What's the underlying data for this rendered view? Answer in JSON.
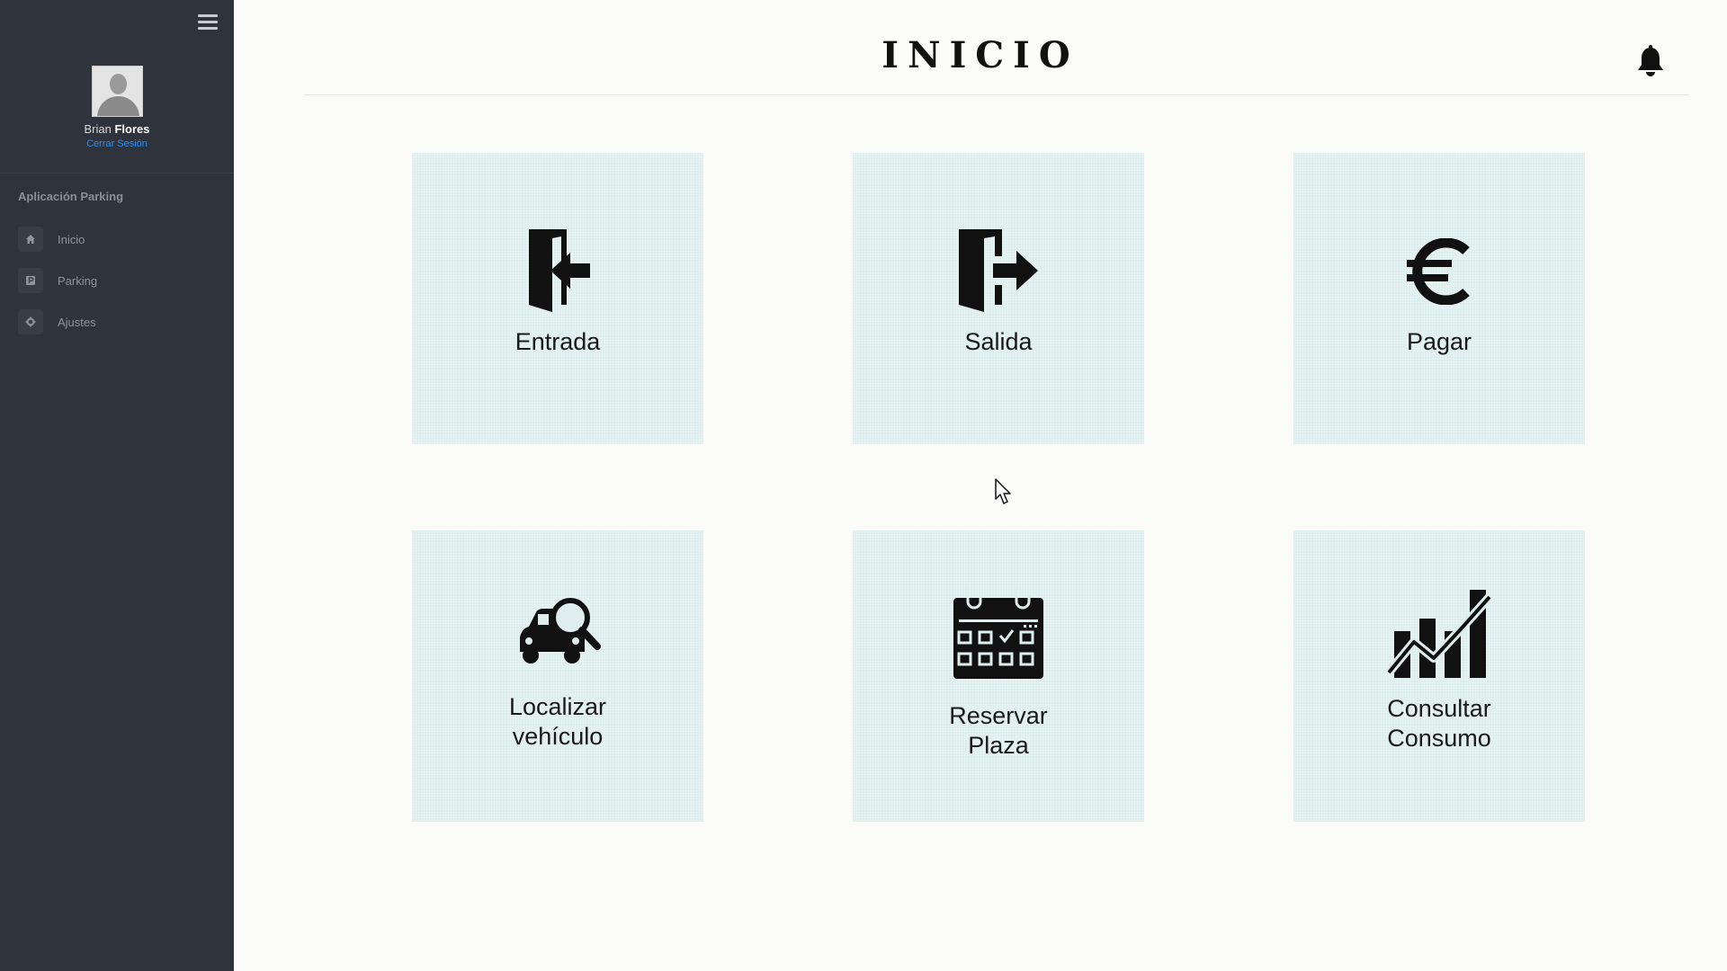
{
  "sidebar": {
    "user": {
      "first_name": "Brian",
      "last_name": "Flores",
      "logout_label": "Cerrar Sesión"
    },
    "section_title": "Aplicación Parking",
    "items": [
      {
        "label": "Inicio",
        "icon": "home-icon"
      },
      {
        "label": "Parking",
        "icon": "parking-icon"
      },
      {
        "label": "Ajustes",
        "icon": "gear-icon"
      }
    ]
  },
  "header": {
    "title": "INICIO",
    "notification_icon": "bell-icon"
  },
  "tiles": [
    {
      "line1": "Entrada",
      "line2": "",
      "icon": "door-enter-icon"
    },
    {
      "line1": "Salida",
      "line2": "",
      "icon": "door-exit-icon"
    },
    {
      "line1": "Pagar",
      "line2": "",
      "icon": "euro-icon"
    },
    {
      "line1": "Localizar",
      "line2": "vehículo",
      "icon": "car-search-icon"
    },
    {
      "line1": "Reservar",
      "line2": "Plaza",
      "icon": "calendar-icon"
    },
    {
      "line1": "Consultar",
      "line2": "Consumo",
      "icon": "growth-chart-icon"
    }
  ],
  "colors": {
    "sidebar_bg": "#2f333b",
    "tile_bg": "#deeeee",
    "link": "#2d8ef0",
    "page_bg": "#fbfbfa"
  }
}
